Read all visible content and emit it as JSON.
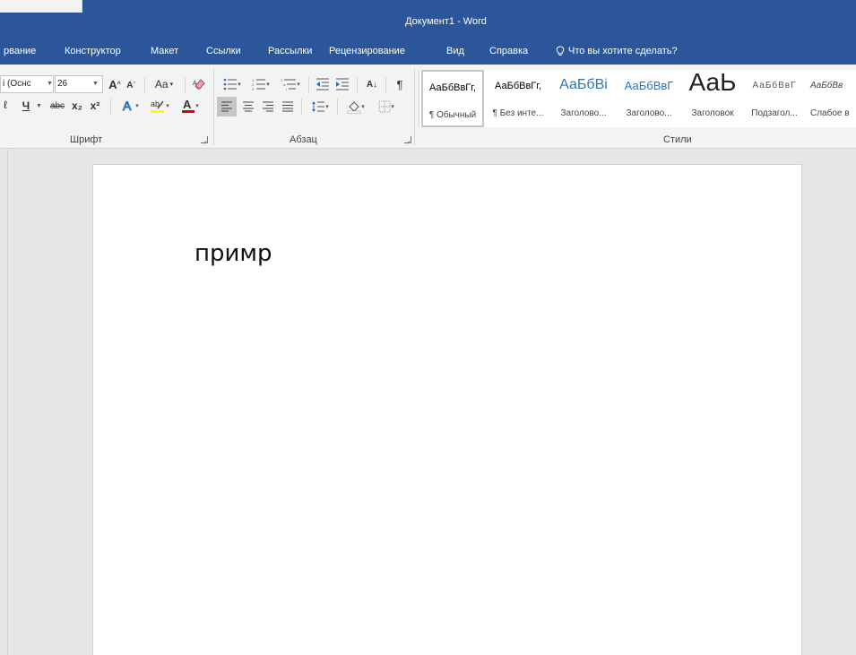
{
  "window": {
    "title": "Документ1 - Word"
  },
  "tabs": [
    {
      "label": "рвание"
    },
    {
      "label": "Конструктор"
    },
    {
      "label": "Макет"
    },
    {
      "label": "Ссылки"
    },
    {
      "label": "Рассылки"
    },
    {
      "label": "Рецензирование"
    },
    {
      "label": "Вид"
    },
    {
      "label": "Справка"
    },
    {
      "label": "Что вы хотите сделать?"
    }
  ],
  "font_group": {
    "font_name": "i (Оснс",
    "font_size": "26",
    "grow_font": "A",
    "shrink_font": "A",
    "change_case": "Aa",
    "underline": "Ч",
    "strikethrough": "abc",
    "subscript": "x₂",
    "superscript": "x²",
    "label": "Шрифт"
  },
  "paragraph_group": {
    "sort": "A↓",
    "pilcrow": "¶",
    "label": "Абзац"
  },
  "styles_group": {
    "label": "Стили",
    "items": [
      {
        "sample": "АаБбВвГг,",
        "name": "¶ Обычный"
      },
      {
        "sample": "АаБбВвГг,",
        "name": "¶ Без инте..."
      },
      {
        "sample": "АаБбВі",
        "name": "Заголово..."
      },
      {
        "sample": "АаБбВвГ",
        "name": "Заголово..."
      },
      {
        "sample": "АаЬ",
        "name": "Заголовок"
      },
      {
        "sample": "АаБбВвГ",
        "name": "Подзагол..."
      },
      {
        "sample": "АаБбВв",
        "name": "Слабое в"
      }
    ]
  },
  "document": {
    "text": "примр"
  },
  "colors": {
    "brand": "#2b579a",
    "highlight": "#ffff00",
    "font_color": "#e00000"
  }
}
